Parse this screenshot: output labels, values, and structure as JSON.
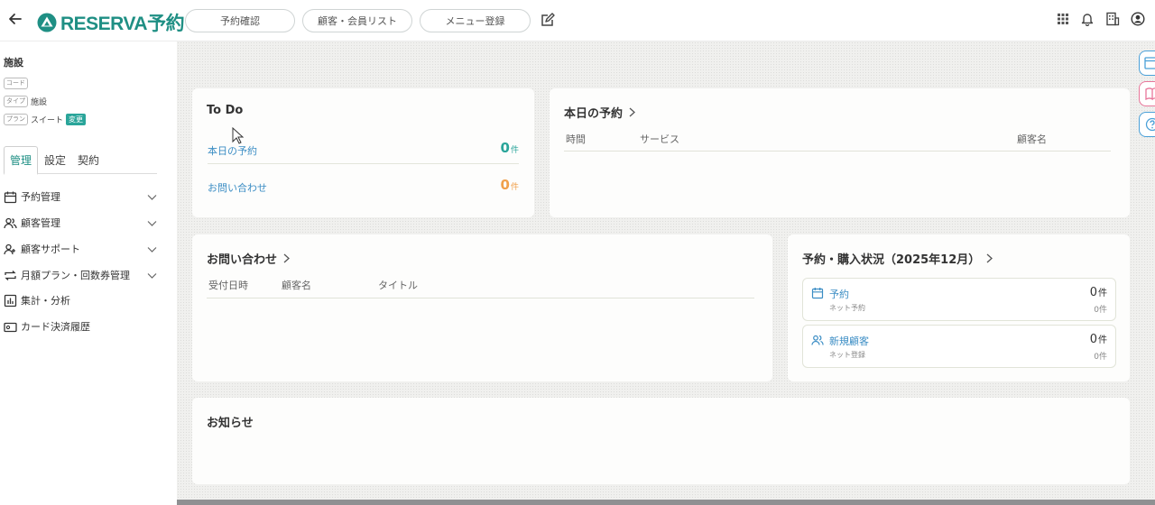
{
  "header": {
    "logo_text": "RESERVA予約",
    "nav": [
      "予約確認",
      "顧客・会員リスト",
      "メニュー登録"
    ]
  },
  "sidebar": {
    "facility_label": "施設",
    "code_tag": "コード",
    "type_tag": "タイプ",
    "type_value": "施設",
    "plan_tag": "プラン",
    "plan_value": "スイート",
    "change_button": "変更",
    "tabs": [
      "管理",
      "設定",
      "契約"
    ],
    "menu": [
      "予約管理",
      "顧客管理",
      "顧客サポート",
      "月額プラン・回数券管理",
      "集計・分析",
      "カード決済履歴"
    ]
  },
  "todo": {
    "title": "To Do",
    "items": [
      {
        "label": "本日の予約",
        "count": "0",
        "unit": "件",
        "color": "#2aa59a"
      },
      {
        "label": "お問い合わせ",
        "count": "0",
        "unit": "件",
        "color": "#f0a04b"
      }
    ]
  },
  "today": {
    "title": "本日の予約",
    "columns": [
      "時間",
      "サービス",
      "顧客名"
    ]
  },
  "inquiries": {
    "title": "お問い合わせ",
    "columns": [
      "受付日時",
      "顧客名",
      "タイトル"
    ]
  },
  "status": {
    "title": "予約・購入状況（2025年12月）",
    "items": [
      {
        "label": "予約",
        "sub": "ネット予約",
        "value": "0",
        "unit": "件",
        "sub_value": "0件"
      },
      {
        "label": "新規顧客",
        "sub": "ネット登録",
        "value": "0",
        "unit": "件",
        "sub_value": "0件"
      }
    ]
  },
  "news": {
    "title": "お知らせ"
  },
  "colors": {
    "accent": "#1f8f84",
    "link": "#3b8dc4",
    "orange": "#f0a04b",
    "pink": "#e8769a",
    "blue": "#4aa0d8"
  }
}
